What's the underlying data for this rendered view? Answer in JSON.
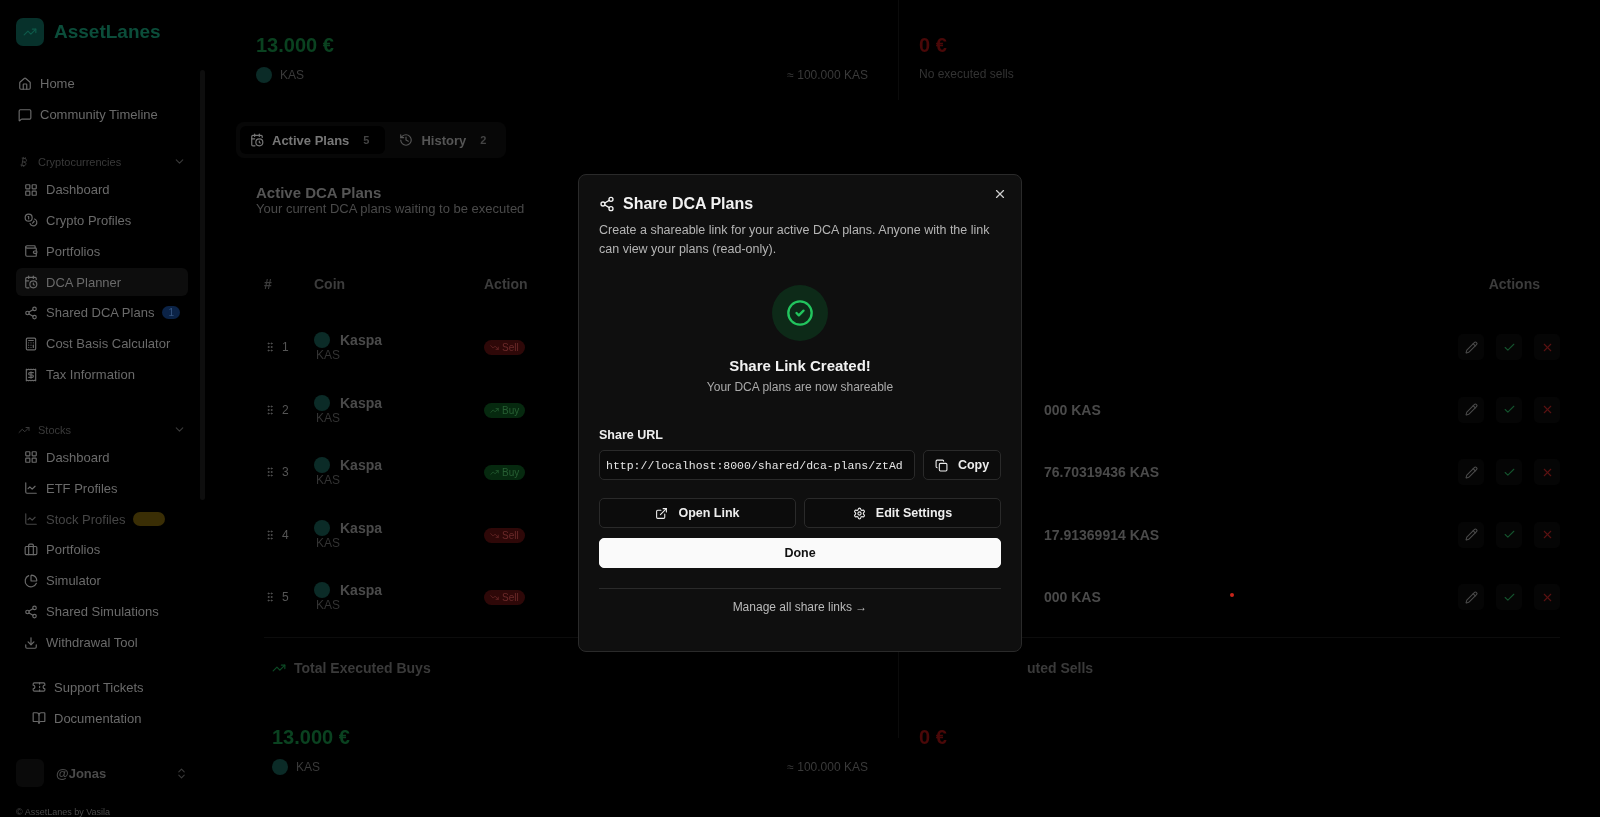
{
  "sidebar": {
    "logo": "AssetLanes",
    "top_items": [
      {
        "label": "Home",
        "selected": false
      },
      {
        "label": "Community Timeline",
        "selected": false
      }
    ],
    "sections": [
      {
        "title": "Cryptocurrencies",
        "expanded": true,
        "items": [
          {
            "label": "Dashboard",
            "selected": false,
            "disabled": false
          },
          {
            "label": "Crypto Profiles",
            "selected": false,
            "disabled": false
          },
          {
            "label": "Portfolios",
            "selected": false,
            "disabled": false
          },
          {
            "label": "DCA Planner",
            "selected": true,
            "disabled": false
          },
          {
            "label": "Shared DCA Plans",
            "selected": false,
            "disabled": false,
            "badge": "1"
          },
          {
            "label": "Cost Basis Calculator",
            "selected": false,
            "disabled": false
          },
          {
            "label": "Tax Information",
            "selected": false,
            "disabled": false
          }
        ]
      },
      {
        "title": "Stocks",
        "expanded": true,
        "items": [
          {
            "label": "Dashboard",
            "selected": false,
            "disabled": false
          },
          {
            "label": "ETF Profiles",
            "selected": false,
            "disabled": false
          },
          {
            "label": "Stock Profiles",
            "selected": false,
            "disabled": true,
            "tag": true
          },
          {
            "label": "Portfolios",
            "selected": false,
            "disabled": false
          },
          {
            "label": "Simulator",
            "selected": false,
            "disabled": false
          },
          {
            "label": "Shared Simulations",
            "selected": false,
            "disabled": false
          },
          {
            "label": "Withdrawal Tool",
            "selected": false,
            "disabled": false
          }
        ]
      }
    ],
    "bottom_items": [
      {
        "label": "Support Tickets"
      },
      {
        "label": "Documentation"
      }
    ],
    "user": {
      "name": "@Jonas"
    },
    "footer": "© AssetLanes by Vasila"
  },
  "top_summary": {
    "buys": {
      "amount": "13.000 €",
      "coin": "KAS",
      "approx": "≈ 100.000 KAS"
    },
    "sells": {
      "amount": "0 €",
      "note": "No executed sells"
    }
  },
  "tabs": [
    {
      "label": "Active Plans",
      "count": "5",
      "selected": true
    },
    {
      "label": "History",
      "count": "2",
      "selected": false
    }
  ],
  "plans": {
    "title": "Active DCA Plans",
    "subtitle": "Your current DCA plans waiting to be executed",
    "columns": {
      "number": "#",
      "coin": "Coin",
      "action": "Action",
      "actions": "Actions"
    },
    "rows": [
      {
        "number": "1",
        "coin": "Kaspa",
        "symbol": "KAS",
        "action": "Sell",
        "kind": "sell",
        "amount": ""
      },
      {
        "number": "2",
        "coin": "Kaspa",
        "symbol": "KAS",
        "action": "Buy",
        "kind": "buy",
        "amount": "000 KAS"
      },
      {
        "number": "3",
        "coin": "Kaspa",
        "symbol": "KAS",
        "action": "Buy",
        "kind": "buy",
        "amount": "76.70319436 KAS"
      },
      {
        "number": "4",
        "coin": "Kaspa",
        "symbol": "KAS",
        "action": "Sell",
        "kind": "sell",
        "amount": "17.91369914 KAS"
      },
      {
        "number": "5",
        "coin": "Kaspa",
        "symbol": "KAS",
        "action": "Sell",
        "kind": "sell",
        "amount": "000 KAS"
      }
    ]
  },
  "totals": {
    "buys": {
      "title": "Total Executed Buys",
      "amount": "13.000 €",
      "coin": "KAS",
      "approx": "≈ 100.000 KAS"
    },
    "sells": {
      "title": "uted Sells",
      "amount": "0 €"
    }
  },
  "dialog": {
    "title": "Share DCA Plans",
    "description": "Create a shareable link for your active DCA plans. Anyone with the link can view your plans (read-only).",
    "success_title": "Share Link Created!",
    "success_text": "Your DCA plans are now shareable",
    "url_label": "Share URL",
    "url": "http://localhost:8000/shared/dca-plans/ztAd",
    "copy": "Copy",
    "open": "Open Link",
    "settings": "Edit Settings",
    "done": "Done",
    "manage": "Manage all share links →"
  }
}
